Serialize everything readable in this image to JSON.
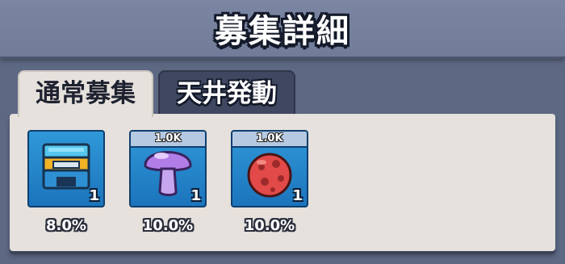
{
  "header": {
    "title": "募集詳細"
  },
  "tabs": [
    {
      "label": "通常募集",
      "active": true
    },
    {
      "label": "天井発動",
      "active": false
    }
  ],
  "items": [
    {
      "icon": "chest-icon",
      "badge": "",
      "quantity": "1",
      "rate": "8.0%"
    },
    {
      "icon": "purple-mushroom-icon",
      "badge": "1.0K",
      "quantity": "1",
      "rate": "10.0%"
    },
    {
      "icon": "red-spotted-ball-icon",
      "badge": "1.0K",
      "quantity": "1",
      "rate": "10.0%"
    }
  ],
  "colors": {
    "background": "#5d6883",
    "panel": "#e6e1dc",
    "card": "#2f98d8",
    "badge": "#b5c9e2"
  }
}
